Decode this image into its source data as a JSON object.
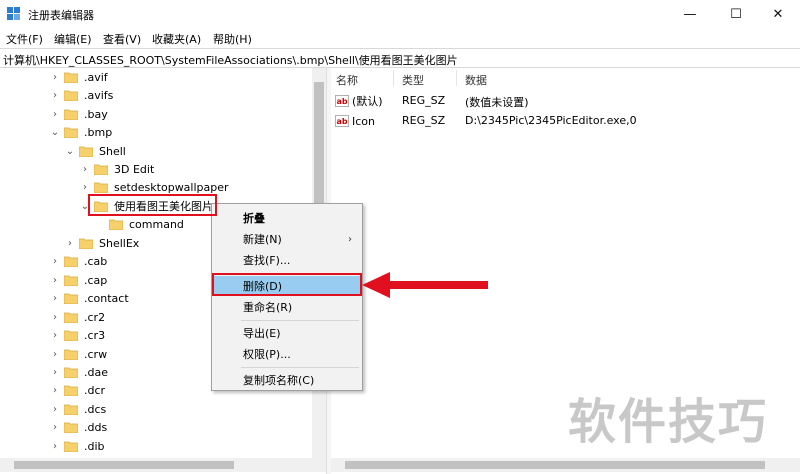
{
  "window": {
    "title": "注册表编辑器",
    "min": "—",
    "max": "☐",
    "close": "✕"
  },
  "menu": [
    "文件(F)",
    "编辑(E)",
    "查看(V)",
    "收藏夹(A)",
    "帮助(H)"
  ],
  "address": "计算机\\HKEY_CLASSES_ROOT\\SystemFileAssociations\\.bmp\\Shell\\使用看图王美化图片",
  "tree": [
    {
      "label": ".avif",
      "chev": "›"
    },
    {
      "label": ".avifs",
      "chev": "›"
    },
    {
      "label": ".bay",
      "chev": "›"
    },
    {
      "label": ".bmp",
      "chev": "⌄"
    },
    {
      "label": "Shell",
      "chev": "⌄"
    },
    {
      "label": "3D Edit",
      "chev": "›"
    },
    {
      "label": "setdesktopwallpaper",
      "chev": "›"
    },
    {
      "label": "使用看图王美化图片",
      "chev": "⌄"
    },
    {
      "label": "command",
      "chev": ""
    },
    {
      "label": "ShellEx",
      "chev": "›"
    },
    {
      "label": ".cab",
      "chev": "›"
    },
    {
      "label": ".cap",
      "chev": "›"
    },
    {
      "label": ".contact",
      "chev": "›"
    },
    {
      "label": ".cr2",
      "chev": "›"
    },
    {
      "label": ".cr3",
      "chev": "›"
    },
    {
      "label": ".crw",
      "chev": "›"
    },
    {
      "label": ".dae",
      "chev": "›"
    },
    {
      "label": ".dcr",
      "chev": "›"
    },
    {
      "label": ".dcs",
      "chev": "›"
    },
    {
      "label": ".dds",
      "chev": "›"
    },
    {
      "label": ".dib",
      "chev": "›"
    }
  ],
  "list": {
    "headers": {
      "name": "名称",
      "type": "类型",
      "data": "数据"
    },
    "rows": [
      {
        "icon": "ab",
        "name": "(默认)",
        "type": "REG_SZ",
        "data": "(数值未设置)"
      },
      {
        "icon": "ab",
        "name": "Icon",
        "type": "REG_SZ",
        "data": "D:\\2345Pic\\2345PicEditor.exe,0"
      }
    ]
  },
  "context_menu": {
    "collapse": "折叠",
    "new": "新建(N)",
    "submenu_arrow": "›",
    "find": "查找(F)...",
    "delete": "删除(D)",
    "rename": "重命名(R)",
    "export": "导出(E)",
    "permissions": "权限(P)...",
    "copy_key_name": "复制项名称(C)"
  },
  "watermark": "软件技巧",
  "colors": {
    "highlight": "#99ccf1",
    "annotation": "#e0101e",
    "folder": "#f6d16b"
  }
}
